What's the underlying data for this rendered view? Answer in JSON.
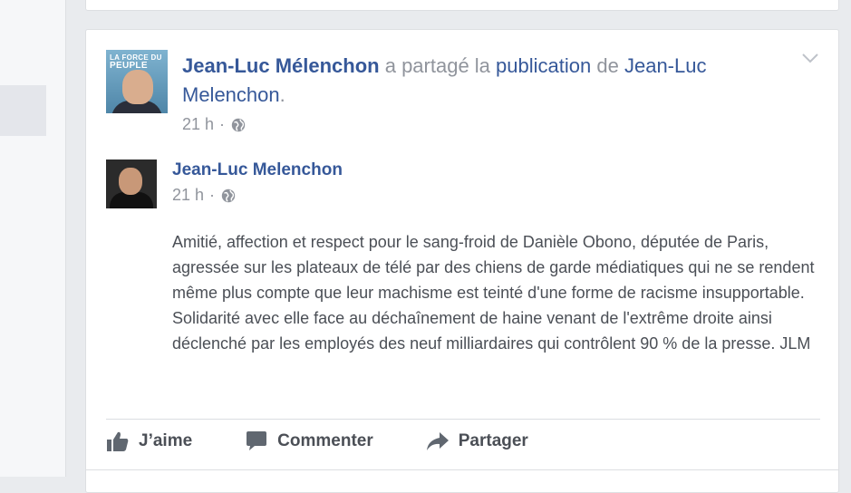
{
  "post": {
    "sharer_name": "Jean-Luc Mélenchon",
    "shared_text": "a partagé la",
    "publication_link": "publication",
    "de_text": "de",
    "original_author_link": "Jean-Luc Melenchon",
    "period": ".",
    "timestamp": "21 h",
    "dot": "·",
    "avatar_caption_line1": "LA FORCE DU",
    "avatar_caption_line2": "PEUPLE"
  },
  "shared": {
    "author": "Jean-Luc Melenchon",
    "timestamp": "21 h",
    "dot": "·",
    "text": "Amitié, affection et respect pour le sang-froid de Danièle Obono, députée de Paris, agressée sur les plateaux de télé par des chiens de garde médiatiques qui ne se rendent même plus compte que leur machisme est teinté d'une forme de racisme insupportable. Solidarité avec elle face au déchaînement de haine venant de l'extrême droite ainsi déclenché par les employés des neuf milliardaires qui contrôlent 90 % de la presse. JLM"
  },
  "actions": {
    "like": "J’aime",
    "comment": "Commenter",
    "share": "Partager"
  },
  "icons": {
    "like": "thumbs-up-icon",
    "comment": "comment-icon",
    "share": "share-arrow-icon",
    "privacy": "globe-icon",
    "menu": "chevron-down-icon"
  },
  "colors": {
    "link": "#365899",
    "meta": "#90949c",
    "body_text": "#4b4f56",
    "background": "#e9ebee"
  }
}
